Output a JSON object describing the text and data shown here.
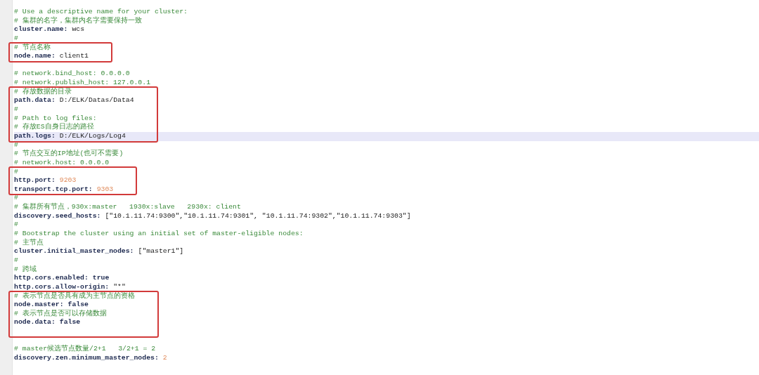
{
  "editor": {
    "blocks": [
      {
        "boxed": false,
        "lines": [
          {
            "kind": "comment",
            "text": "# Use a descriptive name for your cluster:",
            "current": false
          },
          {
            "kind": "comment",
            "text": "# 集群的名字，集群内名字需要保持一致",
            "current": false
          },
          {
            "kind": "text",
            "key": "cluster.name:",
            "value": "wcs",
            "current": false
          },
          {
            "kind": "comment",
            "text": "#",
            "current": false
          }
        ]
      },
      {
        "boxed": true,
        "lines": [
          {
            "kind": "comment",
            "text": "# 节点名称",
            "current": false
          },
          {
            "kind": "text",
            "key": "node.name:",
            "value": "client1",
            "current": false
          }
        ]
      },
      {
        "boxed": false,
        "lines": [
          {
            "kind": "blank",
            "current": false
          },
          {
            "kind": "comment",
            "text": "# network.bind_host: 0.0.0.0",
            "current": false
          },
          {
            "kind": "comment",
            "text": "# network.publish_host: 127.0.0.1",
            "current": false
          }
        ]
      },
      {
        "boxed": true,
        "lines": [
          {
            "kind": "comment",
            "text": "# 存放数据的目录",
            "current": false
          },
          {
            "kind": "text",
            "key": "path.data:",
            "value": "D:/ELK/Datas/Data4",
            "current": false
          },
          {
            "kind": "comment",
            "text": "#",
            "current": false
          },
          {
            "kind": "comment",
            "text": "# Path to log files:",
            "current": false
          },
          {
            "kind": "comment",
            "text": "# 存放ES自身日志的路径",
            "current": false
          },
          {
            "kind": "text",
            "key": "path.logs:",
            "value": "D:/ELK/Logs/Log4",
            "current": true
          }
        ]
      },
      {
        "boxed": false,
        "lines": [
          {
            "kind": "comment",
            "text": "#",
            "current": false
          },
          {
            "kind": "comment",
            "text": "# 节点交互的IP地址(也可不需要)",
            "current": false
          },
          {
            "kind": "comment",
            "text": "# network.host: 0.0.0.0",
            "current": false
          }
        ]
      },
      {
        "boxed": true,
        "lines": [
          {
            "kind": "comment",
            "text": "#",
            "current": false
          },
          {
            "kind": "number",
            "key": "http.port:",
            "value": "9203",
            "current": false
          },
          {
            "kind": "number",
            "key": "transport.tcp.port:",
            "value": "9303",
            "current": false
          }
        ]
      },
      {
        "boxed": false,
        "lines": [
          {
            "kind": "comment",
            "text": "#",
            "current": false
          },
          {
            "kind": "comment",
            "text": "# 集群所有节点，930x:master   1930x:slave   2930x: client",
            "current": false
          },
          {
            "kind": "text",
            "key": "discovery.seed_hosts:",
            "value": "[\"10.1.11.74:9300\",\"10.1.11.74:9301\", \"10.1.11.74:9302\",\"10.1.11.74:9303\"]",
            "current": false
          },
          {
            "kind": "comment",
            "text": "#",
            "current": false
          },
          {
            "kind": "comment",
            "text": "# Bootstrap the cluster using an initial set of master-eligible nodes:",
            "current": false
          },
          {
            "kind": "comment",
            "text": "# 主节点",
            "current": false
          },
          {
            "kind": "text",
            "key": "cluster.initial_master_nodes:",
            "value": "[\"master1\"]",
            "current": false
          },
          {
            "kind": "comment",
            "text": "#",
            "current": false
          },
          {
            "kind": "comment",
            "text": "# 跨域",
            "current": false
          },
          {
            "kind": "keyword",
            "key": "http.cors.enabled:",
            "value": "true",
            "current": false
          },
          {
            "kind": "text",
            "key": "http.cors.allow-origin:",
            "value": "\"*\"",
            "current": false
          }
        ]
      },
      {
        "boxed": true,
        "lines": [
          {
            "kind": "comment",
            "text": "# 表示节点是否具有成为主节点的资格",
            "current": false
          },
          {
            "kind": "keyword",
            "key": "node.master:",
            "value": "false",
            "current": false
          },
          {
            "kind": "comment",
            "text": "# 表示节点是否可以存储数据",
            "current": false
          },
          {
            "kind": "keyword",
            "key": "node.data:",
            "value": "false",
            "current": false
          },
          {
            "kind": "blank",
            "current": false
          }
        ]
      },
      {
        "boxed": false,
        "lines": [
          {
            "kind": "blank",
            "current": false
          },
          {
            "kind": "comment",
            "text": "# master候选节点数量/2+1   3/2+1 = 2",
            "current": false
          },
          {
            "kind": "number",
            "key": "discovery.zen.minimum_master_nodes:",
            "value": "2",
            "current": false
          }
        ]
      }
    ]
  }
}
